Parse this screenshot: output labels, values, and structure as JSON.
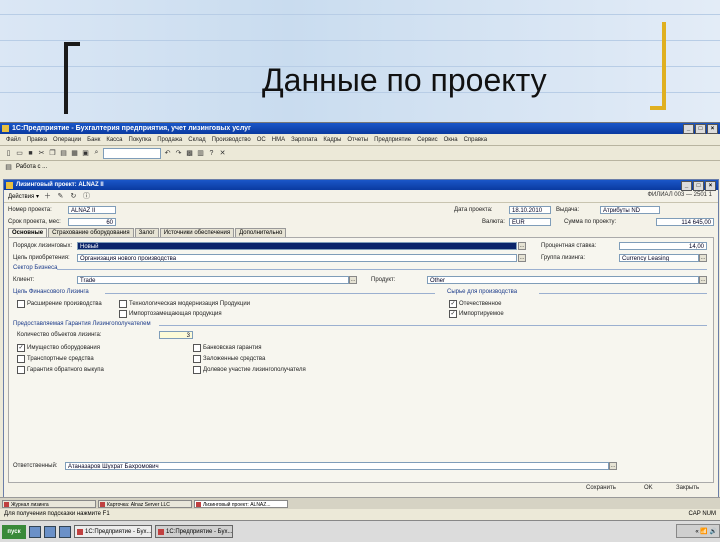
{
  "slide": {
    "title": "Данные по проекту"
  },
  "app_window": {
    "title": "1С:Предприятие - Бухгалтерия предприятия, учет лизинговых услуг",
    "controls": [
      "_",
      "□",
      "×"
    ],
    "menu": [
      "Файл",
      "Правка",
      "Операции",
      "Банк",
      "Касса",
      "Покупка",
      "Продажа",
      "Склад",
      "Производство",
      "ОС",
      "НМА",
      "Зарплата",
      "Кадры",
      "Отчеты",
      "Предприятие",
      "Сервис",
      "Окна",
      "Справка"
    ],
    "toolbar2_label": "Работа с ..."
  },
  "child_window": {
    "title": "Лизинговый проект: ALNAZ II",
    "controls": [
      "_",
      "□",
      "×"
    ],
    "toolbar": {
      "actions_label": "Действия ▾",
      "right_text": "ФИЛИАЛ 003 — 2501 1"
    },
    "header": {
      "name_label": "Номер проекта:",
      "name_value": "ALNAZ II",
      "date_label": "Дата проекта:",
      "date_value": "18.10.2010",
      "kind_label": "Выдача:",
      "kind_value": "Атрибуты ND",
      "term_label": "Срок проекта, мес:",
      "term_value": "60",
      "currency_label": "Валюта:",
      "currency_value": "EUR",
      "amount_label": "Сумма по проекту:",
      "amount_value": "114 645,00"
    },
    "tabs": [
      "Основные",
      "Страхование оборудования",
      "Залог",
      "Источники обеспечения",
      "Дополнительно"
    ],
    "main": {
      "direction_label": "Порядок лизинговых:",
      "direction_value": "Новый",
      "purpose_label": "Цель приобретения:",
      "purpose_value": "Организация нового производства",
      "percent_label": "Процентная ставка:",
      "percent_value": "14,00",
      "group_label": "Группа лизинга:",
      "group_value": "Currency Leasing",
      "sector_title": "Сектор Бизнеса",
      "client_label": "Клиент:",
      "client_value": "Trade",
      "product_label": "Продукт:",
      "product_value": "Other",
      "goal_title": "Цель Финансового Лизинга",
      "goal_options": [
        {
          "label": "Расширение производства",
          "checked": false
        },
        {
          "label": "Технологическая модернизация Продукции",
          "checked": false
        },
        {
          "label": "Импортозамещающая продукция",
          "checked": false
        }
      ],
      "raw_title": "Сырье для производства",
      "raw_options": [
        {
          "label": "Отечественное",
          "checked": true
        },
        {
          "label": "Импортируемое",
          "checked": true
        }
      ],
      "guarantee_title": "Предоставляемая Гарантия Лизингополучателем",
      "guarantee_count_label": "Количество объектов лизинга:",
      "guarantee_count_value": "3",
      "guarantee_left": [
        {
          "label": "Имущество оборудования",
          "checked": true
        },
        {
          "label": "Транспортные средства",
          "checked": false
        },
        {
          "label": "Гарантия обратного выкупа",
          "checked": false
        }
      ],
      "guarantee_right": [
        {
          "label": "Банковская гарантия",
          "checked": false
        },
        {
          "label": "Заложенные средства",
          "checked": false
        },
        {
          "label": "Долевое участие лизингополучателя",
          "checked": false
        }
      ],
      "responsible_label": "Ответственный:",
      "responsible_value": "Атаназаров Шухрат Бахромович"
    },
    "status_buttons": [
      "Сохранить",
      "OK",
      "Закрыть"
    ]
  },
  "inner_taskbar": [
    "Журнал лизинга",
    "Карточка: Alnaz Server LLC",
    "Лизинговый проект: ALNAZ..."
  ],
  "hint_bar": {
    "left": "Для получения подсказки нажмите F1",
    "right": "CAP NUM"
  },
  "windows_taskbar": {
    "start": "пуск",
    "buttons": [
      "1С:Предприятие - Бух...",
      "1С:Предприятие - Бух..."
    ],
    "tray": "« 📶 🔊"
  }
}
